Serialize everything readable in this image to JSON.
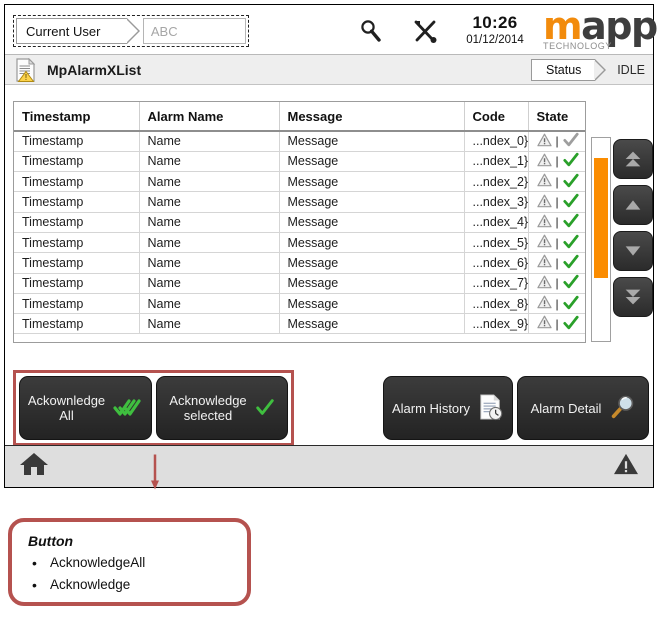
{
  "topbar": {
    "user_label": "Current User",
    "user_value": "",
    "user_placeholder": "ABC",
    "search_icon": "magnifier-icon",
    "tools_icon": "tools-icon",
    "time": "10:26",
    "date": "01/12/2014",
    "logo": {
      "part1": "m",
      "part2": "app",
      "tagline": "TECHNOLOGY",
      "accent_color": "#f28b0c",
      "dark_color": "#3e3e3e"
    }
  },
  "titlebar": {
    "icon": "document-alarm-icon",
    "title": "MpAlarmXList",
    "status_label": "Status",
    "status_value": "IDLE"
  },
  "table": {
    "columns": [
      "Timestamp",
      "Alarm Name",
      "Message",
      "Code",
      "State"
    ],
    "rows": [
      {
        "timestamp": "Timestamp",
        "name": "Name",
        "message": "Message",
        "code": "...ndex_0}",
        "state_ack": false
      },
      {
        "timestamp": "Timestamp",
        "name": "Name",
        "message": "Message",
        "code": "...ndex_1}",
        "state_ack": true
      },
      {
        "timestamp": "Timestamp",
        "name": "Name",
        "message": "Message",
        "code": "...ndex_2}",
        "state_ack": true
      },
      {
        "timestamp": "Timestamp",
        "name": "Name",
        "message": "Message",
        "code": "...ndex_3}",
        "state_ack": true
      },
      {
        "timestamp": "Timestamp",
        "name": "Name",
        "message": "Message",
        "code": "...ndex_4}",
        "state_ack": true
      },
      {
        "timestamp": "Timestamp",
        "name": "Name",
        "message": "Message",
        "code": "...ndex_5}",
        "state_ack": true
      },
      {
        "timestamp": "Timestamp",
        "name": "Name",
        "message": "Message",
        "code": "...ndex_6}",
        "state_ack": true
      },
      {
        "timestamp": "Timestamp",
        "name": "Name",
        "message": "Message",
        "code": "...ndex_7}",
        "state_ack": true
      },
      {
        "timestamp": "Timestamp",
        "name": "Name",
        "message": "Message",
        "code": "...ndex_8}",
        "state_ack": true
      },
      {
        "timestamp": "Timestamp",
        "name": "Name",
        "message": "Message",
        "code": "...ndex_9}",
        "state_ack": true
      }
    ],
    "state_separator": "|",
    "state_warning_icon": "warning-triangle-icon",
    "state_check_icon": "check-icon"
  },
  "scrollbar": {
    "thumb_color": "#fb8c00",
    "buttons": [
      {
        "name": "scroll-page-up-button",
        "icon": "double-chevron-up-icon"
      },
      {
        "name": "scroll-up-button",
        "icon": "chevron-up-icon"
      },
      {
        "name": "scroll-down-button",
        "icon": "chevron-down-icon"
      },
      {
        "name": "scroll-page-down-button",
        "icon": "double-chevron-down-icon"
      }
    ]
  },
  "buttons": {
    "ack_all_line1": "Ackownledge",
    "ack_all_line2": "All",
    "ack_all_icon": "triple-check-icon",
    "ack_selected_line1": "Acknowledge",
    "ack_selected_line2": "selected",
    "ack_selected_icon": "check-icon",
    "alarm_history": "Alarm History",
    "alarm_history_icon": "document-clock-icon",
    "alarm_detail": "Alarm Detail",
    "alarm_detail_icon": "magnifier-icon"
  },
  "bottombar": {
    "home_icon": "home-icon",
    "alarm_icon": "warning-triangle-icon"
  },
  "callout": {
    "title": "Button",
    "items": [
      "AcknowledgeAll",
      "Acknowledge"
    ],
    "border_color": "#b5524f"
  }
}
